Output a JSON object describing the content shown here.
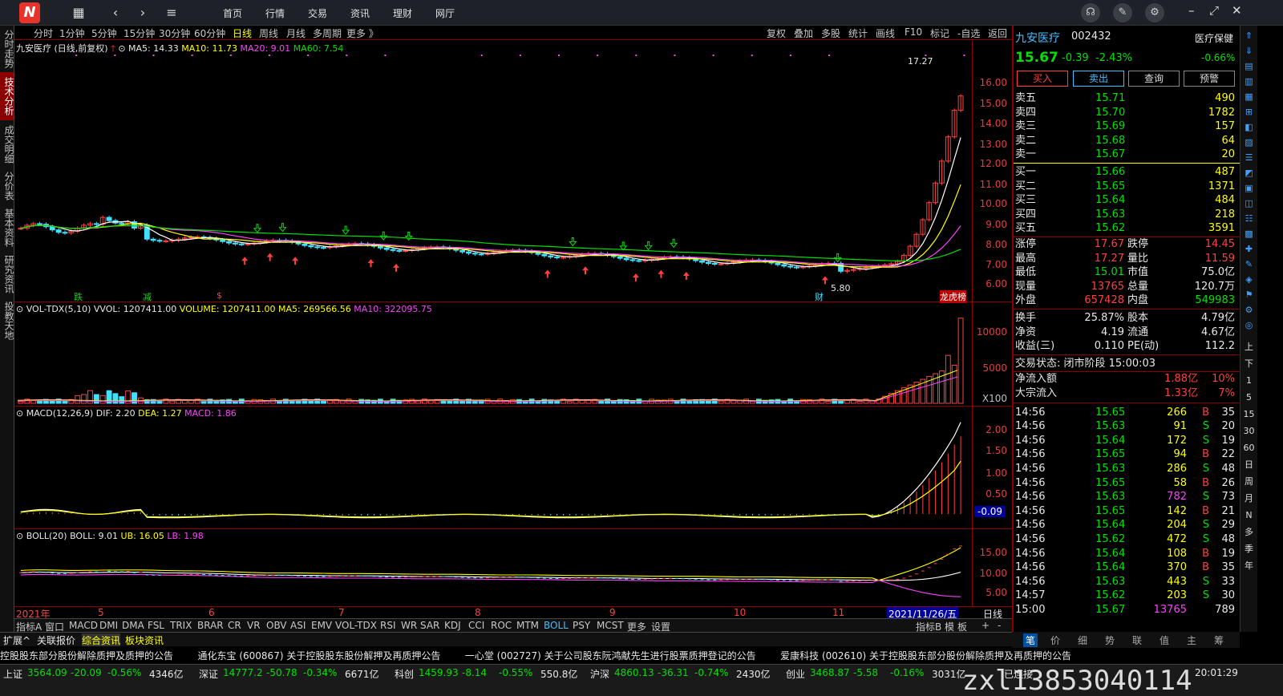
{
  "topbar": {
    "nav": [
      "首页",
      "行情",
      "交易",
      "资讯",
      "理财",
      "网厅"
    ]
  },
  "left_tabs": [
    "分时走势",
    "技术分析",
    "成交明细",
    "分价表",
    "基本资料",
    "研究资讯",
    "投教天地"
  ],
  "period_bar": {
    "items": [
      "分时",
      "1分钟",
      "5分钟",
      "15分钟",
      "30分钟",
      "60分钟",
      "日线",
      "周线",
      "月线",
      "多周期",
      "更多 》"
    ],
    "active": "日线",
    "right_items": [
      "复权",
      "叠加",
      "多股",
      "统计",
      "画线",
      "F10",
      "标记",
      "-自选",
      "返回"
    ]
  },
  "main_chart": {
    "stock_label": "九安医疗 (日线,前复权)",
    "ma5": "MA5: 14.33",
    "ma10": "MA10: 11.73",
    "ma20": "MA20: 9.01",
    "ma60": "MA60: 7.54",
    "y_ticks": [
      "16.00",
      "15.00",
      "14.00",
      "13.00",
      "12.00",
      "11.00",
      "10.00",
      "9.00",
      "8.00",
      "7.00",
      "6.00"
    ],
    "high_label": "17.27",
    "low_label": "5.80",
    "event_labels": [
      "跌",
      "减",
      "$",
      "财",
      "龙虎榜"
    ]
  },
  "vol_chart": {
    "label": "VOL-TDX(5,10)",
    "vvol": "VVOL: 1207411.00",
    "volume": "VOLUME: 1207411.00",
    "ma5": "MA5: 269566.56",
    "ma10": "MA10: 322095.75",
    "y_ticks": [
      "10000",
      "5000"
    ],
    "unit": "X100"
  },
  "macd_chart": {
    "label": "MACD(12,26,9)",
    "dif": "DIF: 2.20",
    "dea": "DEA: 1.27",
    "macd": "MACD: 1.86",
    "y_ticks": [
      "2.00",
      "1.50",
      "1.00",
      "0.50"
    ],
    "cur_tag": "-0.09"
  },
  "boll_chart": {
    "label": "BOLL(20)",
    "boll": "BOLL: 9.01",
    "ub": "UB: 16.05",
    "lb": "LB: 1.98",
    "y_ticks": [
      "15.00",
      "10.00",
      "5.00"
    ]
  },
  "x_axis": {
    "labels": [
      "2021年",
      "5",
      "6",
      "7",
      "8",
      "9",
      "10",
      "11"
    ],
    "cursor_date": "2021/11/26/五",
    "period": "日线"
  },
  "indicator_tabs": {
    "items": [
      "指标A",
      "窗口",
      "MACD",
      "DMI",
      "DMA",
      "FSL",
      "TRIX",
      "BRAR",
      "CR",
      "VR",
      "OBV",
      "ASI",
      "EMV",
      "VOL-TDX",
      "RSI",
      "WR",
      "SAR",
      "KDJ",
      "CCI",
      "ROC",
      "MTM",
      "BOLL",
      "PSY",
      "MCST",
      "更多",
      "设置"
    ],
    "active": "BOLL",
    "right_items": [
      "指标B",
      "模",
      "板",
      "+",
      "-"
    ]
  },
  "quote": {
    "name": "九安医疗",
    "code": "002432",
    "sector": "医疗保健",
    "price": "15.67",
    "change": "-0.39",
    "change_pct": "-2.43%",
    "sector_pct": "-0.66%",
    "buttons": [
      "买入",
      "卖出",
      "查询",
      "预警"
    ],
    "asks": [
      {
        "label": "卖五",
        "price": "15.71",
        "vol": "490"
      },
      {
        "label": "卖四",
        "price": "15.70",
        "vol": "1782"
      },
      {
        "label": "卖三",
        "price": "15.69",
        "vol": "157"
      },
      {
        "label": "卖二",
        "price": "15.68",
        "vol": "64"
      },
      {
        "label": "卖一",
        "price": "15.67",
        "vol": "20"
      }
    ],
    "bids": [
      {
        "label": "买一",
        "price": "15.66",
        "vol": "487"
      },
      {
        "label": "买二",
        "price": "15.65",
        "vol": "1371"
      },
      {
        "label": "买三",
        "price": "15.64",
        "vol": "484"
      },
      {
        "label": "买四",
        "price": "15.63",
        "vol": "218"
      },
      {
        "label": "买五",
        "price": "15.62",
        "vol": "3591"
      }
    ],
    "stats": [
      {
        "l1": "涨停",
        "v1": "17.67",
        "l2": "跌停",
        "v2": "14.45"
      },
      {
        "l1": "最高",
        "v1": "17.27",
        "l2": "量比",
        "v2": "11.59"
      },
      {
        "l1": "最低",
        "v1": "15.01",
        "l2": "市值",
        "v2": "75.0亿"
      },
      {
        "l1": "现量",
        "v1": "13765",
        "l2": "总量",
        "v2": "120.7万"
      },
      {
        "l1": "外盘",
        "v1": "657428",
        "l2": "内盘",
        "v2": "549983"
      }
    ],
    "stats2": [
      {
        "l1": "换手",
        "v1": "25.87%",
        "l2": "股本",
        "v2": "4.79亿"
      },
      {
        "l1": "净资",
        "v1": "4.19",
        "l2": "流通",
        "v2": "4.67亿"
      },
      {
        "l1": "收益(三)",
        "v1": "0.110",
        "l2": "PE(动)",
        "v2": "112.2"
      }
    ],
    "trade_status": "交易状态: 闭市阶段 15:00:03",
    "net_inflow_label": "净流入额",
    "net_inflow": "1.88亿",
    "net_inflow_pct": "10%",
    "block_label": "大宗流入",
    "block_inflow": "1.33亿",
    "block_pct": "7%"
  },
  "ticks": [
    {
      "t": "14:56",
      "p": "15.65",
      "v": "266",
      "d": "B",
      "n": "35"
    },
    {
      "t": "14:56",
      "p": "15.63",
      "v": "91",
      "d": "S",
      "n": "20"
    },
    {
      "t": "14:56",
      "p": "15.64",
      "v": "172",
      "d": "S",
      "n": "19"
    },
    {
      "t": "14:56",
      "p": "15.65",
      "v": "94",
      "d": "B",
      "n": "22"
    },
    {
      "t": "14:56",
      "p": "15.63",
      "v": "286",
      "d": "S",
      "n": "48"
    },
    {
      "t": "14:56",
      "p": "15.65",
      "v": "58",
      "d": "B",
      "n": "26"
    },
    {
      "t": "14:56",
      "p": "15.63",
      "v": "782",
      "d": "S",
      "n": "73"
    },
    {
      "t": "14:56",
      "p": "15.65",
      "v": "142",
      "d": "B",
      "n": "21"
    },
    {
      "t": "14:56",
      "p": "15.64",
      "v": "204",
      "d": "S",
      "n": "29"
    },
    {
      "t": "14:56",
      "p": "15.62",
      "v": "472",
      "d": "S",
      "n": "48"
    },
    {
      "t": "14:56",
      "p": "15.64",
      "v": "108",
      "d": "B",
      "n": "19"
    },
    {
      "t": "14:56",
      "p": "15.64",
      "v": "370",
      "d": "B",
      "n": "35"
    },
    {
      "t": "14:56",
      "p": "15.63",
      "v": "443",
      "d": "S",
      "n": "33"
    },
    {
      "t": "14:57",
      "p": "15.62",
      "v": "203",
      "d": "S",
      "n": "30"
    },
    {
      "t": "15:00",
      "p": "15.67",
      "v": "13765",
      "d": "",
      "n": "789"
    }
  ],
  "right_icons": [
    "上",
    "下",
    "1",
    "5",
    "15",
    "30",
    "60",
    "日",
    "周",
    "月",
    "N",
    "多",
    "季",
    "年"
  ],
  "news_tabs": [
    "扩展^",
    "关联报价",
    "综合资讯",
    "板块资讯"
  ],
  "news_ticker": "控股股东部分股份解除质押及质押的公告        通化东宝 (600867) 关于控股股东股份解押及再质押公告        一心堂 (002727) 关于公司股东阮鸿献先生进行股票质押登记的公告        爱康科技 (002610) 关于控股股东部分股份解除质押及再质押的公告",
  "right_bottom_tabs": [
    "笔",
    "价",
    "细",
    "势",
    "联",
    "值",
    "主",
    "筹"
  ],
  "status": {
    "items": [
      {
        "name": "上证",
        "val": "3564.09",
        "chg": "-20.09",
        "pct": "-0.56%",
        "amt": "4346亿"
      },
      {
        "name": "深证",
        "val": "14777.2",
        "chg": "-50.78",
        "pct": "-0.34%",
        "amt": "6671亿"
      },
      {
        "name": "科创",
        "val": "1459.93",
        "chg": "-8.14",
        "pct": "-0.55%",
        "amt": "550.8亿"
      },
      {
        "name": "沪深",
        "val": "4860.13",
        "chg": "-36.31",
        "pct": "-0.74%",
        "amt": "2430亿"
      },
      {
        "name": "创业",
        "val": "3468.87",
        "chg": "-5.58",
        "pct": "-0.16%",
        "amt": "3031亿"
      }
    ],
    "connection": "已连接",
    "time": "20:01:29"
  },
  "watermark": "zxl13853040114",
  "colors": {
    "up": "#ff4040",
    "down": "#40e0ff",
    "ma5": "#ffffff",
    "ma10": "#ffff00",
    "ma20": "#ff40ff",
    "ma60": "#00e000",
    "border": "#8b0000"
  }
}
